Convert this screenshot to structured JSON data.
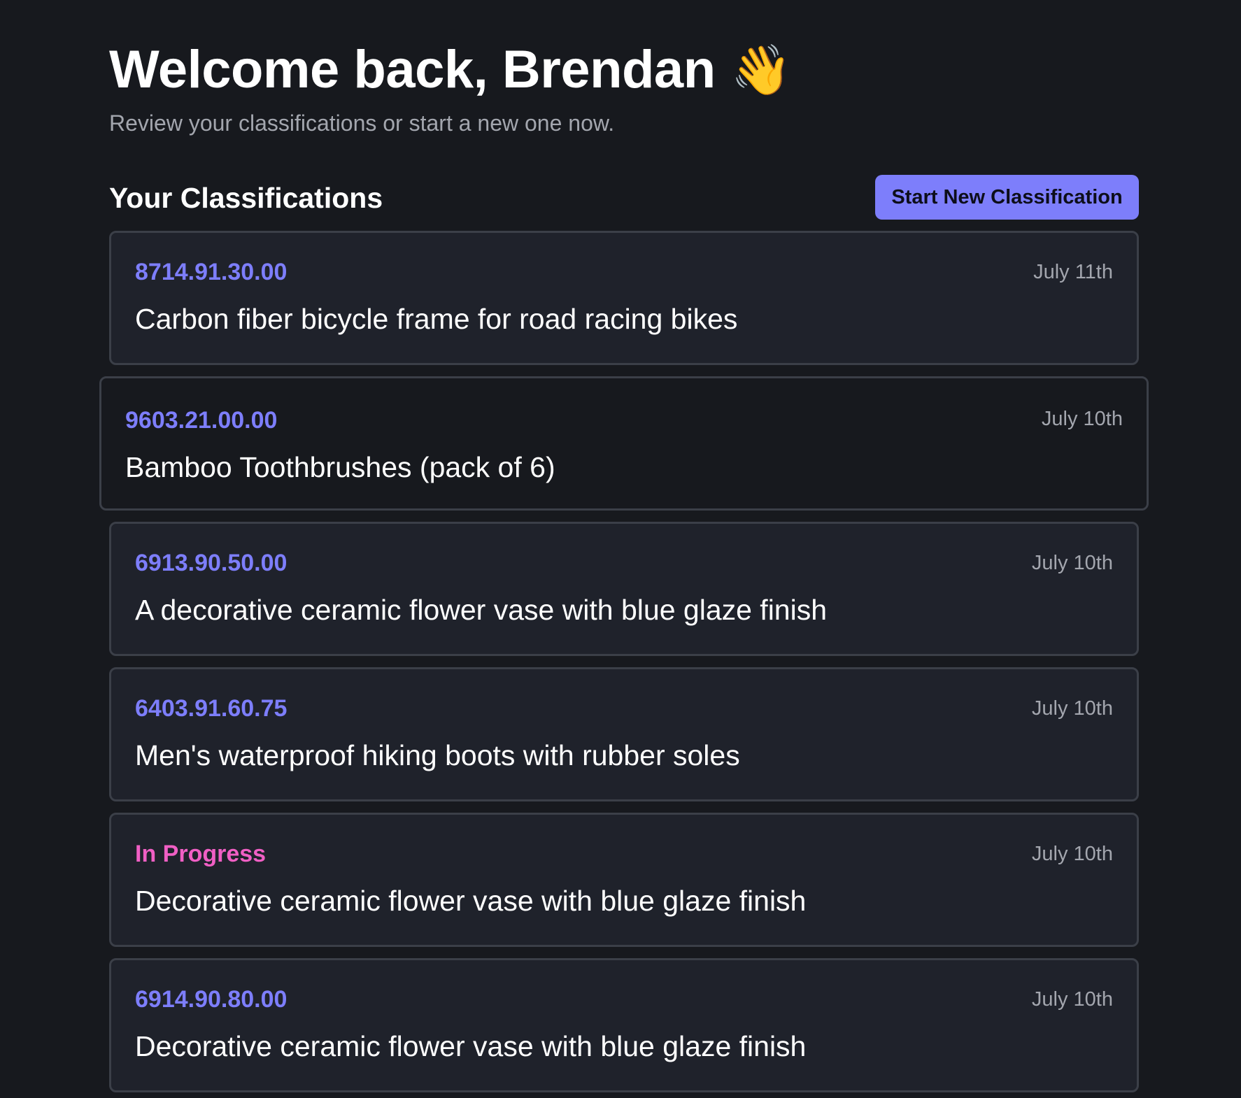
{
  "header": {
    "welcome": "Welcome back, Brendan",
    "wave_emoji": "👋",
    "subtitle": "Review your classifications or start a new one now."
  },
  "section": {
    "title": "Your Classifications",
    "start_button_label": "Start New Classification"
  },
  "classifications": [
    {
      "code": "8714.91.30.00",
      "date": "July 11th",
      "description": "Carbon fiber bicycle frame for road racing bikes"
    },
    {
      "code": "9603.21.00.00",
      "date": "July 10th",
      "description": "Bamboo Toothbrushes (pack of 6)"
    },
    {
      "code": "6913.90.50.00",
      "date": "July 10th",
      "description": "A decorative ceramic flower vase with blue glaze finish"
    },
    {
      "code": "6403.91.60.75",
      "date": "July 10th",
      "description": "Men's waterproof hiking boots with rubber soles"
    },
    {
      "code": "In Progress",
      "date": "July 10th",
      "description": "Decorative ceramic flower vase with blue glaze finish"
    },
    {
      "code": "6914.90.80.00",
      "date": "July 10th",
      "description": "Decorative ceramic flower vase with blue glaze finish"
    }
  ],
  "colors": {
    "background": "#17191e",
    "card_background": "#1f222b",
    "card_border": "#3b3f48",
    "accent": "#7d7efb",
    "in_progress": "#f05fc4",
    "muted_text": "#a3a6ae"
  }
}
